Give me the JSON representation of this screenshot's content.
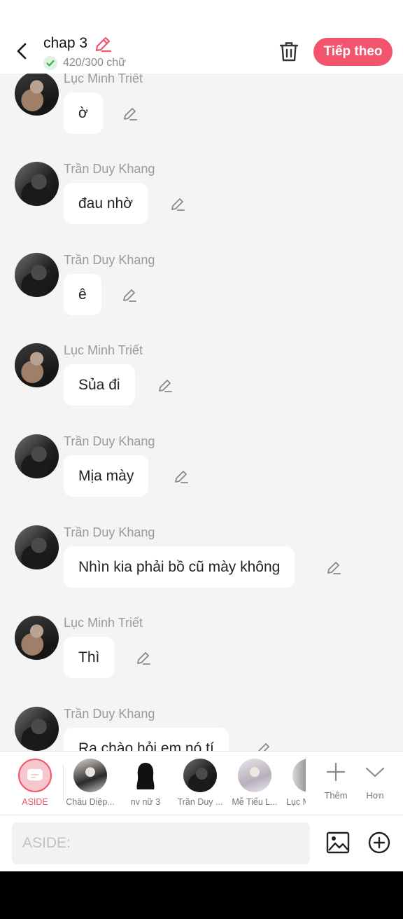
{
  "header": {
    "title": "chap 3",
    "word_count": "420/300 chữ",
    "next_label": "Tiếp theo"
  },
  "colors": {
    "accent": "#f2546d",
    "name": "#9a9a9a",
    "background": "#f4f4f4"
  },
  "messages": [
    {
      "name": "Lục Minh Triết",
      "text": "ờ"
    },
    {
      "name": "Trần Duy Khang",
      "text": "đau nhờ"
    },
    {
      "name": "Trần Duy Khang",
      "text": "ê"
    },
    {
      "name": "Lục Minh Triết",
      "text": "Sủa đi"
    },
    {
      "name": "Trần Duy Khang",
      "text": "Mịa mày"
    },
    {
      "name": "Trần Duy Khang",
      "text": "Nhìn kia phải bồ cũ mày không"
    },
    {
      "name": "Lục Minh Triết",
      "text": "Thì"
    },
    {
      "name": "Trần Duy Khang",
      "text": "Ra chào hỏi em nó tí"
    }
  ],
  "characters": [
    {
      "label": "ASIDE"
    },
    {
      "label": "Châu Diệp..."
    },
    {
      "label": "nv nữ 3"
    },
    {
      "label": "Trần Duy ..."
    },
    {
      "label": "Mễ Tiểu L..."
    },
    {
      "label": "Lục M"
    }
  ],
  "tools": {
    "more_label": "Thêm",
    "collapse_label": "Hơn"
  },
  "input": {
    "placeholder": "ASIDE:"
  }
}
